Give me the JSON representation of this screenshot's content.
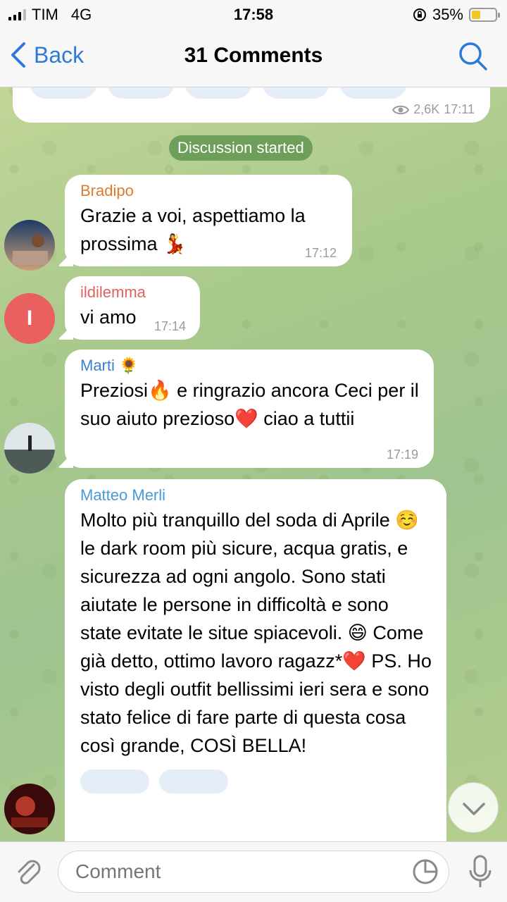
{
  "status_bar": {
    "carrier": "TIM",
    "network": "4G",
    "time": "17:58",
    "battery": "35%"
  },
  "nav": {
    "back_label": "Back",
    "title": "31 Comments"
  },
  "channel_post": {
    "views": "2,6K",
    "time": "17:11"
  },
  "divider": "Discussion started",
  "messages": [
    {
      "author": "Bradipo",
      "author_color": "#e07b2c",
      "text": "Grazie a voi, aspettiamo la prossima 💃",
      "time": "17:12"
    },
    {
      "author": "ildilemma",
      "author_color": "#e0625f",
      "avatar_letter": "I",
      "text": "vi amo",
      "time": "17:14"
    },
    {
      "author": "Marti 🌻",
      "author_color": "#3f7fcf",
      "text": "Preziosi🔥 e ringrazio ancora Ceci per il suo aiuto prezioso❤️ ciao a tuttii",
      "time": "17:19"
    },
    {
      "author": "Matteo Merli",
      "author_color": "#4a9ad6",
      "text": "Molto più tranquillo del soda di Aprile ☺️ le dark room più sicure, acqua gratis, e sicurezza ad ogni angolo. Sono stati aiutate le persone in difficoltà e sono state evitate le situe spiacevoli. 😄 Come già detto, ottimo lavoro ragazz*❤️ PS. Ho visto degli outfit bellissimi ieri sera e sono stato felice di fare parte di questa cosa così grande, COSÌ BELLA!"
    }
  ],
  "input": {
    "placeholder": "Comment"
  },
  "colors": {
    "accent": "#2f7ad8",
    "divider_pill": "#6d9f5b"
  },
  "icons": [
    "back-chevron-icon",
    "search-icon",
    "eye-icon",
    "paperclip-icon",
    "sticker-icon",
    "mic-icon",
    "chevron-down-icon"
  ]
}
